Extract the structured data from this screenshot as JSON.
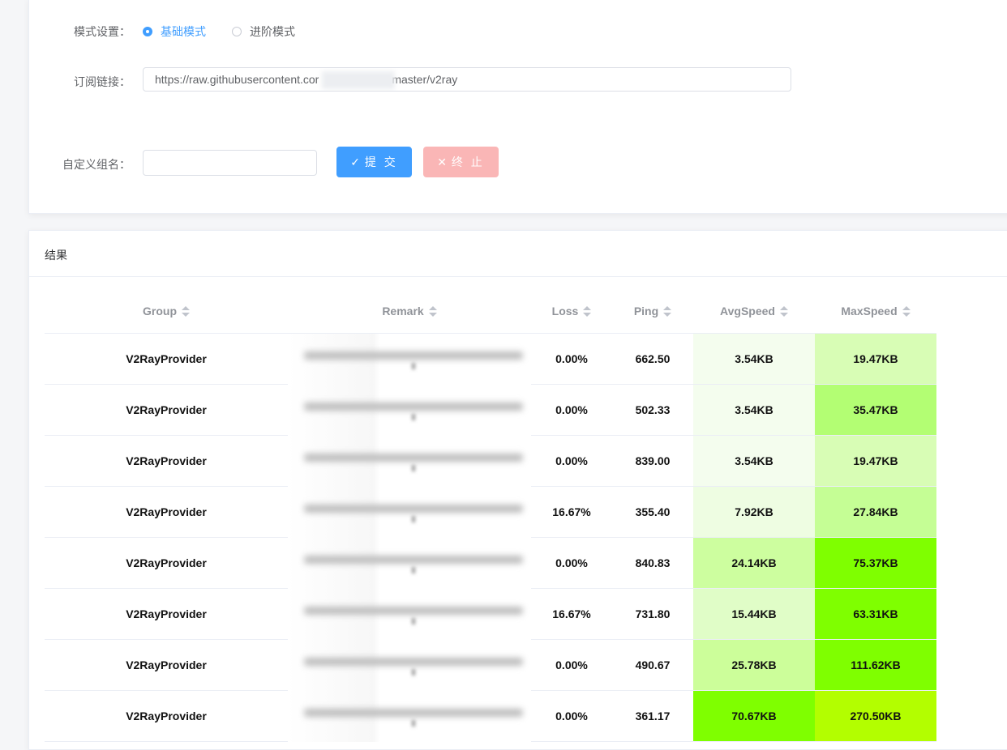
{
  "form": {
    "mode_label": "模式设置：",
    "mode_options": [
      {
        "label": "基础模式",
        "checked": true
      },
      {
        "label": "进阶模式",
        "checked": false
      }
    ],
    "subscription_label": "订阅链接：",
    "subscription_value_prefix": "https://raw.githubusercontent.cor",
    "subscription_value_suffix": "master/v2ray",
    "group_label": "自定义组名：",
    "group_value": "",
    "submit_label": "提 交",
    "stop_label": "终 止"
  },
  "result": {
    "title": "结果",
    "columns": [
      "Group",
      "Remark",
      "Loss",
      "Ping",
      "AvgSpeed",
      "MaxSpeed"
    ],
    "rows": [
      {
        "group": "V2RayProvider",
        "loss": "0.00%",
        "ping": "662.50",
        "avg": "3.54KB",
        "max": "19.47KB",
        "avg_color": "#f4fdee",
        "max_color": "#d8fdb5"
      },
      {
        "group": "V2RayProvider",
        "loss": "0.00%",
        "ping": "502.33",
        "avg": "3.54KB",
        "max": "35.47KB",
        "avg_color": "#f4fdee",
        "max_color": "#b3fe73"
      },
      {
        "group": "V2RayProvider",
        "loss": "0.00%",
        "ping": "839.00",
        "avg": "3.54KB",
        "max": "19.47KB",
        "avg_color": "#f4fdee",
        "max_color": "#d8fdb5"
      },
      {
        "group": "V2RayProvider",
        "loss": "16.67%",
        "ping": "355.40",
        "avg": "7.92KB",
        "max": "27.84KB",
        "avg_color": "#eefde2",
        "max_color": "#c5fe95"
      },
      {
        "group": "V2RayProvider",
        "loss": "0.00%",
        "ping": "840.83",
        "avg": "24.14KB",
        "max": "75.37KB",
        "avg_color": "#cdfe9f",
        "max_color": "#7fff00"
      },
      {
        "group": "V2RayProvider",
        "loss": "16.67%",
        "ping": "731.80",
        "avg": "15.44KB",
        "max": "63.31KB",
        "avg_color": "#e0fdc7",
        "max_color": "#7fff00"
      },
      {
        "group": "V2RayProvider",
        "loss": "0.00%",
        "ping": "490.67",
        "avg": "25.78KB",
        "max": "111.62KB",
        "avg_color": "#ccfe9a",
        "max_color": "#7fff00"
      },
      {
        "group": "V2RayProvider",
        "loss": "0.00%",
        "ping": "361.17",
        "avg": "70.67KB",
        "max": "270.50KB",
        "avg_color": "#7fff00",
        "max_color": "#b3fe00"
      }
    ]
  }
}
